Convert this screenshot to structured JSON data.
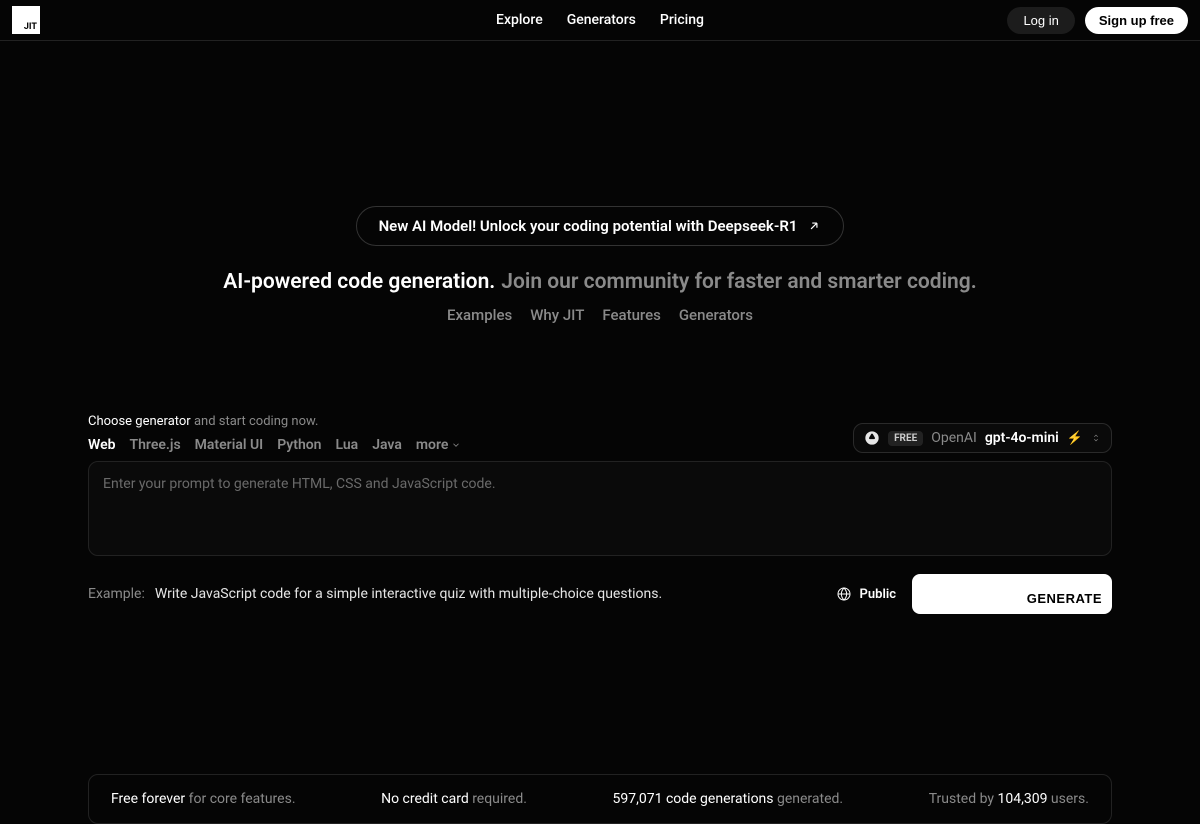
{
  "logo": "JIT",
  "nav": {
    "explore": "Explore",
    "generators": "Generators",
    "pricing": "Pricing"
  },
  "auth": {
    "login": "Log in",
    "signup": "Sign up free"
  },
  "hero": {
    "pill_text": "New AI Model! Unlock your coding potential with Deepseek-R1",
    "headline_white": "AI-powered code generation.",
    "headline_gray": "Join our community for faster and smarter coding.",
    "subnav": {
      "examples": "Examples",
      "why": "Why JIT",
      "features": "Features",
      "generators": "Generators"
    }
  },
  "generator": {
    "choose_white": "Choose generator",
    "choose_gray": " and start coding now.",
    "tabs": {
      "web": "Web",
      "threejs": "Three.js",
      "material": "Material UI",
      "python": "Python",
      "lua": "Lua",
      "java": "Java",
      "more": "more"
    },
    "model": {
      "badge": "FREE",
      "brand": "OpenAI",
      "name": "gpt-4o-mini",
      "bolt": "⚡"
    },
    "prompt_placeholder": "Enter your prompt to generate HTML, CSS and JavaScript code.",
    "example_label": "Example:",
    "example_text": "Write JavaScript code for a simple interactive quiz with multiple-choice questions.",
    "visibility": "Public",
    "generate_btn": "GENERATE"
  },
  "stats": {
    "s1_white": "Free forever",
    "s1_gray": " for core features.",
    "s2_white": "No credit card",
    "s2_gray": " required.",
    "s3_white": "597,071 code generations",
    "s3_gray": " generated.",
    "s4_pre": "Trusted by ",
    "s4_white": "104,309",
    "s4_gray": " users."
  }
}
